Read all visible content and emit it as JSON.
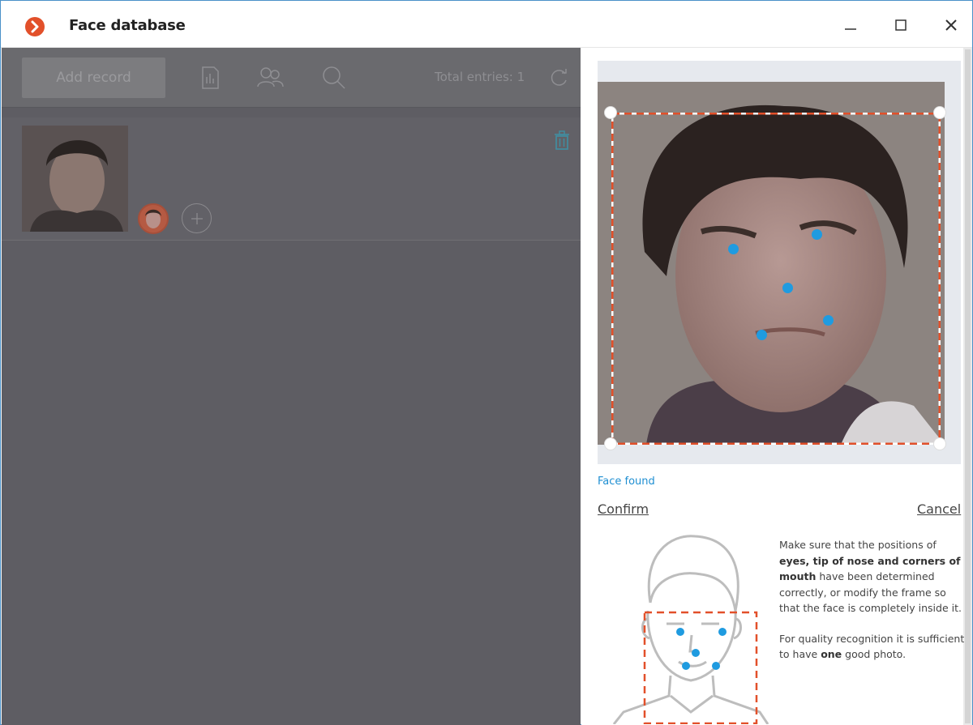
{
  "window": {
    "title": "Face database",
    "controls": {
      "minimize": "—",
      "maximize": "☐",
      "close": "✕"
    }
  },
  "toolbar": {
    "add_record_label": "Add record",
    "total_entries": "Total entries: 1",
    "icons": [
      "report-icon",
      "users-icon",
      "search-icon",
      "refresh-icon"
    ]
  },
  "records": [
    {
      "has_photo": true,
      "photo_count": 1
    }
  ],
  "editor": {
    "status": "Face found",
    "confirm_label": "Confirm",
    "cancel_label": "Cancel",
    "landmark_color": "#1f9be0",
    "frame_color": "#e2502a"
  },
  "hint": {
    "p1_a": "Make sure that the positions of",
    "p1_bold": "eyes, tip of nose and corners of mouth",
    "p1_b": "have been determined correctly, or modify the frame so that the face is completely inside it.",
    "p2_a": "For quality recognition it is sufficient to have",
    "p2_bold": "one",
    "p2_b": "good photo."
  },
  "colors": {
    "accent": "#e2502a",
    "link": "#1f8fd2",
    "overlay": "#5e5d63"
  }
}
